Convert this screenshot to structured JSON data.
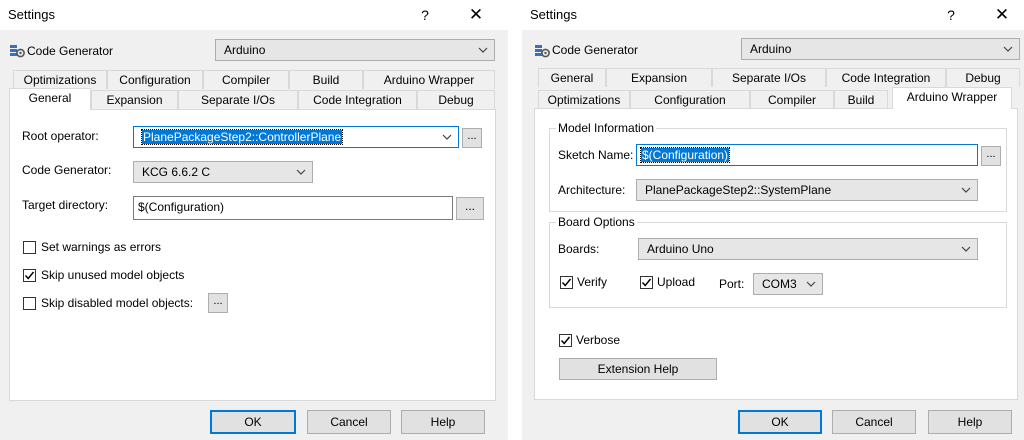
{
  "left_dialog": {
    "title": "Settings",
    "help_glyph": "?",
    "close_glyph": "✕",
    "code_generator_label": "Code Generator",
    "code_generator_value": "Arduino",
    "tabs_row1": [
      "Optimizations",
      "Configuration",
      "Compiler",
      "Build",
      "Arduino Wrapper"
    ],
    "tabs_row2": [
      "General",
      "Expansion",
      "Separate I/Os",
      "Code Integration",
      "Debug"
    ],
    "active_tab": "General",
    "root_operator_label": "Root operator:",
    "root_operator_value": "PlanePackageStep2::ControllerPlane",
    "codegen_label": "Code Generator:",
    "codegen_value": "KCG 6.6.2 C",
    "target_dir_label": "Target directory:",
    "target_dir_value": "$(Configuration)",
    "browse_label": "...",
    "checkboxes": [
      {
        "label": "Set warnings as errors",
        "checked": false
      },
      {
        "label": "Skip unused model objects",
        "checked": true
      },
      {
        "label": "Skip disabled model objects:",
        "checked": false
      }
    ],
    "ok_label": "OK",
    "cancel_label": "Cancel",
    "help_label": "Help"
  },
  "right_dialog": {
    "title": "Settings",
    "help_glyph": "?",
    "close_glyph": "✕",
    "code_generator_label": "Code Generator",
    "code_generator_value": "Arduino",
    "tabs_row1": [
      "General",
      "Expansion",
      "Separate I/Os",
      "Code Integration",
      "Debug"
    ],
    "tabs_row2": [
      "Optimizations",
      "Configuration",
      "Compiler",
      "Build",
      "Arduino Wrapper"
    ],
    "active_tab": "Arduino Wrapper",
    "model_info_title": "Model Information",
    "sketch_name_label": "Sketch Name:",
    "sketch_name_value": "$(Configuration)",
    "architecture_label": "Architecture:",
    "architecture_value": "PlanePackageStep2::SystemPlane",
    "board_options_title": "Board Options",
    "boards_label": "Boards:",
    "boards_value": "Arduino Uno",
    "verify_label": "Verify",
    "verify_checked": true,
    "upload_label": "Upload",
    "upload_checked": true,
    "port_label": "Port:",
    "port_value": "COM3",
    "verbose_label": "Verbose",
    "verbose_checked": true,
    "extension_help_label": "Extension Help",
    "browse_label": "...",
    "ok_label": "OK",
    "cancel_label": "Cancel",
    "help_label": "Help"
  }
}
